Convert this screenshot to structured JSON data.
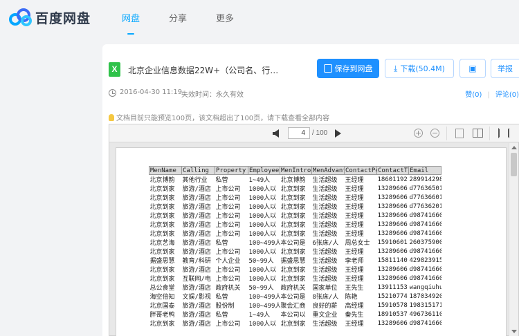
{
  "brand": {
    "name": "百度网盘"
  },
  "nav": [
    {
      "label": "网盘",
      "active": true
    },
    {
      "label": "分享",
      "active": false
    },
    {
      "label": "更多",
      "active": false
    }
  ],
  "file": {
    "icon_letter": "X",
    "name": "北京企业信息数据22W+（公司名、行业...",
    "date": "2016-04-30 11:19",
    "expiry": "失效时间：永久有效"
  },
  "actions": {
    "save": "保存到网盘",
    "download": "下载(50.4M)",
    "qr": "▣",
    "report": "举报"
  },
  "meta_links": {
    "count": "0",
    "comment": "评论(0)"
  },
  "notice": "文档目前只能预览100页，该文档超出了100页，请下载查看全部内容",
  "viewer": {
    "page": "4",
    "total": "/ 100"
  },
  "table": {
    "headers": [
      "MenName",
      "Calling",
      "Property",
      "EmployeeN",
      "MenIntrod",
      "MenAdvant",
      "ContactPe",
      "ContactTe",
      "Email"
    ],
    "rows": [
      [
        "北京博韵",
        "其他行业",
        "私营",
        "1~49人",
        "北京博韵",
        "生活超级",
        "王经理",
        "18601192",
        "289914298"
      ],
      [
        "北京到家",
        "旅游/酒店",
        "上市公司",
        "1000人以",
        "北京到家",
        "生活超级",
        "王经理",
        "13289606",
        "d77636501"
      ],
      [
        "北京到家",
        "旅游/酒店",
        "上市公司",
        "1000人以",
        "北京到家",
        "生活超级",
        "王经理",
        "13289606",
        "d77636601"
      ],
      [
        "北京到家",
        "旅游/酒店",
        "上市公司",
        "1000人以",
        "北京到家",
        "生活超级",
        "王经理",
        "13289606",
        "d77636201"
      ],
      [
        "北京到家",
        "旅游/酒店",
        "上市公司",
        "1000人以",
        "北京到家",
        "生活超级",
        "王经理",
        "13289606",
        "d98741660"
      ],
      [
        "北京到家",
        "旅游/酒店",
        "上市公司",
        "1000人以",
        "北京到家",
        "生活超级",
        "王经理",
        "13289606",
        "d98741660"
      ],
      [
        "北京到家",
        "旅游/酒店",
        "上市公司",
        "1000人以",
        "北京到家",
        "生活超级",
        "王经理",
        "13289606",
        "d98741660"
      ],
      [
        "北京艺海",
        "旅游/酒店",
        "私营",
        "100~499人",
        "本公司是",
        "6张床/人",
        "周总女士",
        "15910601",
        "260375900"
      ],
      [
        "北京到家",
        "旅游/酒店",
        "上市公司",
        "1000人以",
        "北京到家",
        "生活超级",
        "王经理",
        "13289606",
        "d98741660"
      ],
      [
        "据盛思慧",
        "教育/科研",
        "个人企业",
        "50~99人",
        "据盛思慧",
        "生活超级",
        "李老师",
        "15811140",
        "429823915"
      ],
      [
        "北京到家",
        "旅游/酒店",
        "上市公司",
        "1000人以",
        "北京到家",
        "生活超级",
        "王经理",
        "13289606",
        "d98741660"
      ],
      [
        "北京到家",
        "互联网/电",
        "上市公司",
        "1000人以",
        "北京到家",
        "生活超级",
        "王经理",
        "13289606",
        "d98741660"
      ],
      [
        "总公食堂",
        "旅游/酒店",
        "政府机关",
        "50~99人",
        "政府机关",
        "国家单位",
        "王先生",
        "13911153",
        "wangqiuhui"
      ],
      [
        "海空倍知",
        "文娱/影视",
        "私营",
        "100~499人",
        "本公司是",
        "8张床/人",
        "陈艳",
        "15210774",
        "187034920"
      ],
      [
        "北京国泰",
        "旅游/酒店",
        "股份制",
        "100~499人",
        "聚会汇商",
        "良好的薪",
        "高经理",
        "15910578",
        "198315171"
      ],
      [
        "胖哥老鸭",
        "旅游/酒店",
        "私营",
        "1~49人",
        "本公司以",
        "重文企业",
        "秦先生",
        "18910537",
        "496736110"
      ],
      [
        "北京到家",
        "旅游/酒店",
        "上市公司",
        "1000人以",
        "北京到家",
        "生活超级",
        "王经理",
        "13289606",
        "d98741660"
      ]
    ]
  }
}
